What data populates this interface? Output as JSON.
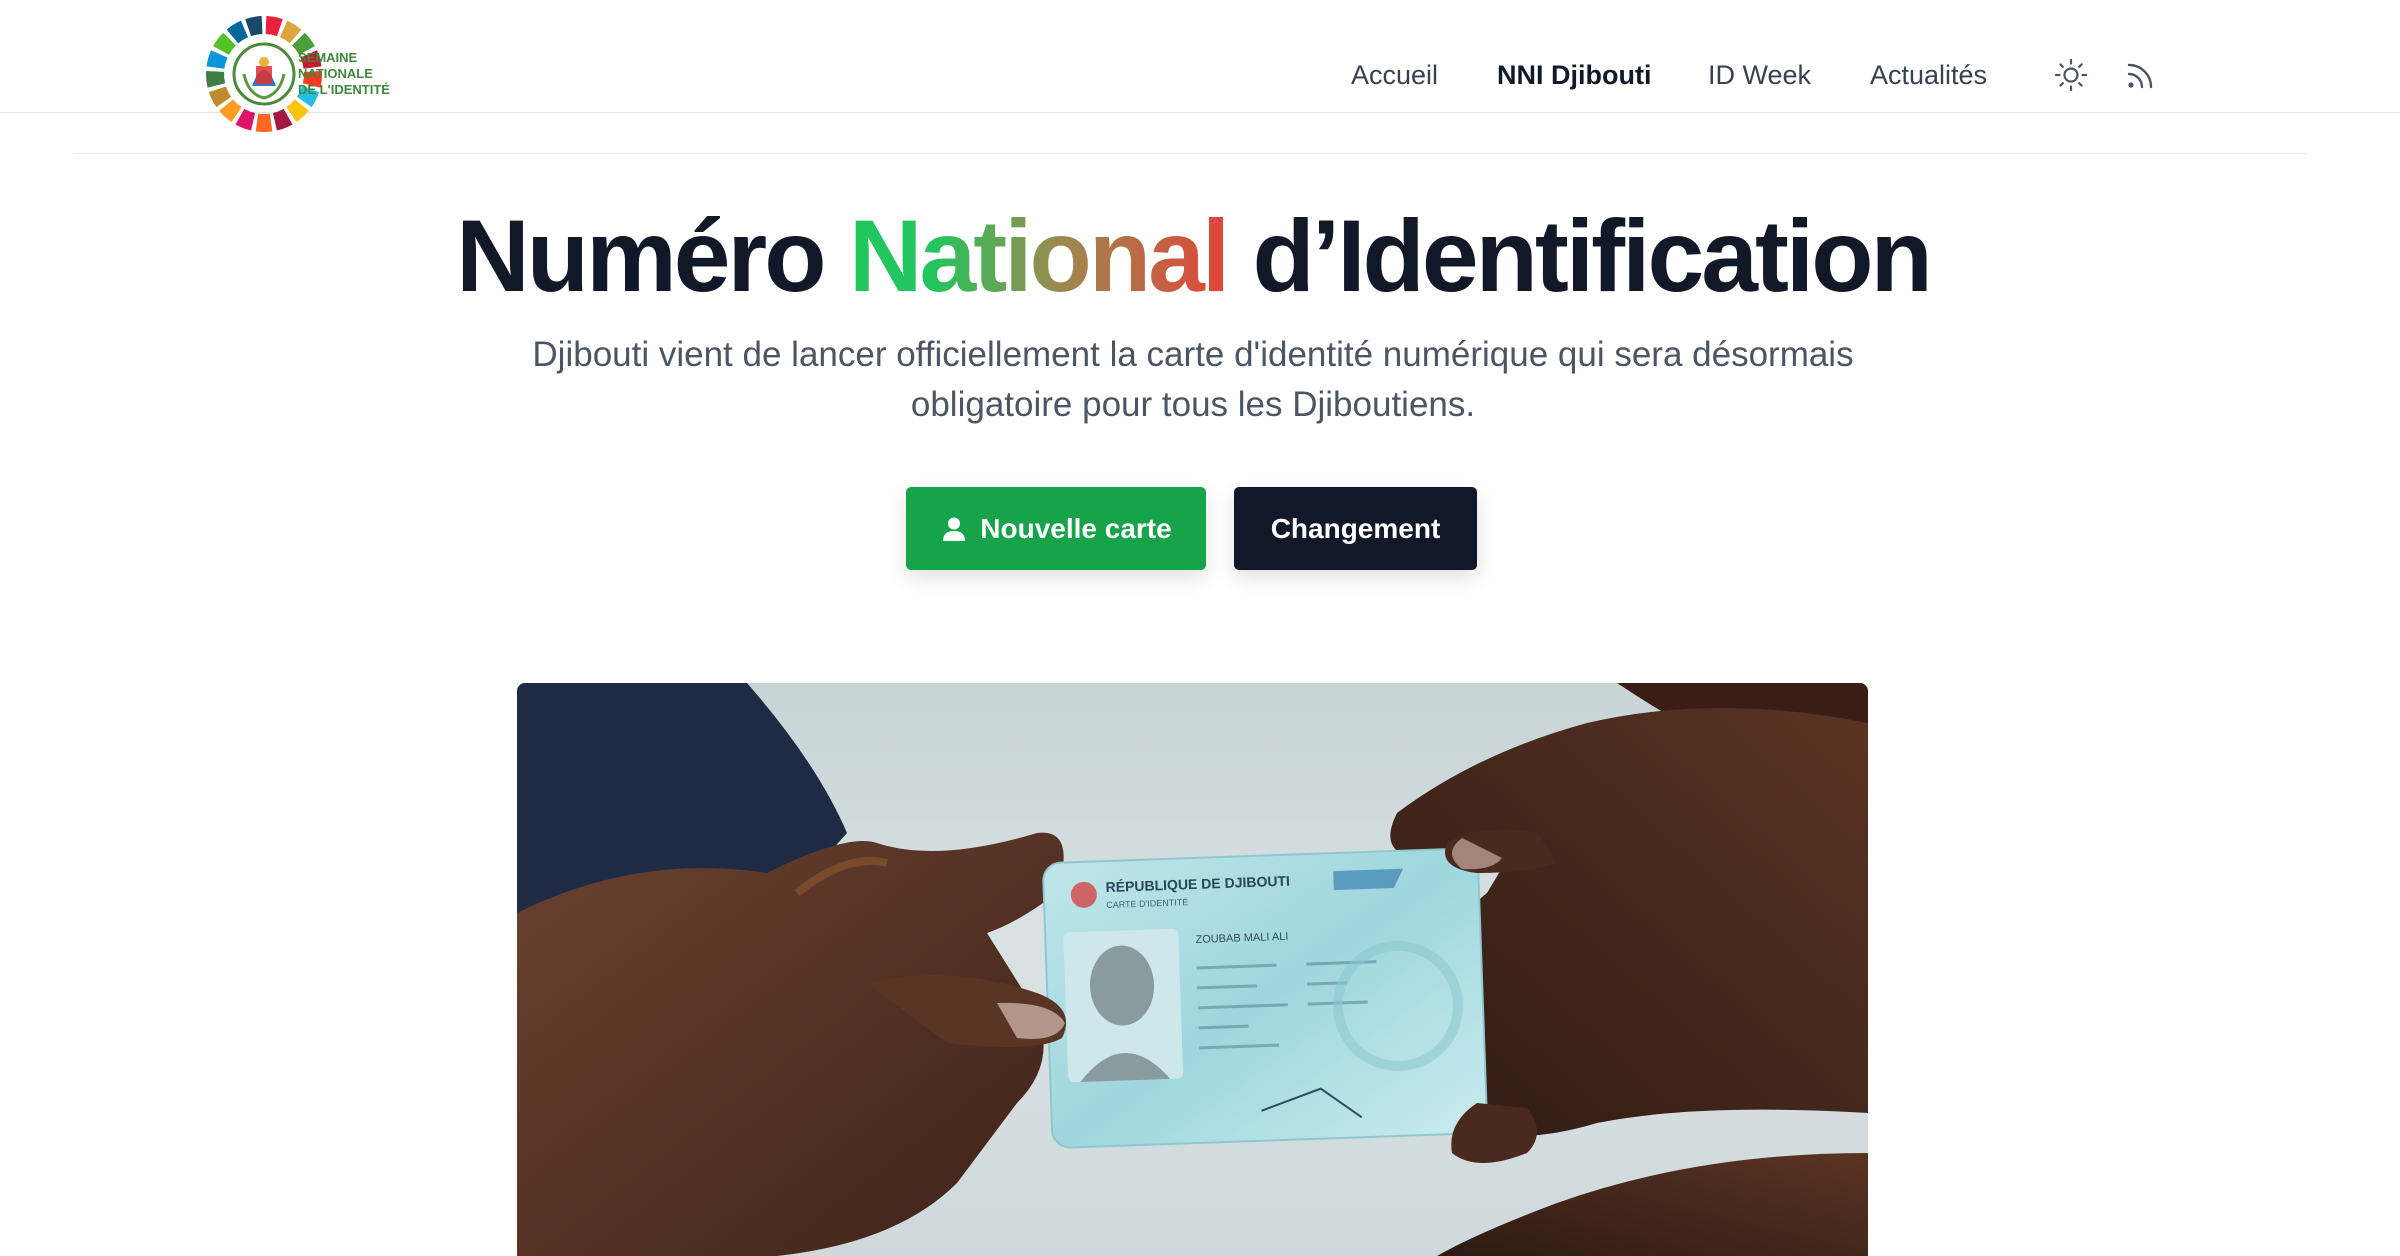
{
  "logo": {
    "lines": [
      "SEMAINE",
      "NATIONALE",
      "DE L'IDENTITÉ"
    ]
  },
  "nav": {
    "items": [
      {
        "label": "Accueil",
        "active": false
      },
      {
        "label": "NNI Djibouti",
        "active": true
      },
      {
        "label": "ID Week",
        "active": false
      },
      {
        "label": "Actualités",
        "active": false
      }
    ],
    "theme_icon": "sun-icon",
    "rss_icon": "rss-icon"
  },
  "hero": {
    "title_before": "Numéro ",
    "title_highlight": "National",
    "title_after": " d’Identification",
    "subtitle": "Djibouti vient de lancer officiellement la carte d'identité numérique qui sera désormais obligatoire pour tous les Djiboutiens.",
    "primary_button": "Nouvelle carte",
    "primary_icon": "user-icon",
    "secondary_button": "Changement"
  },
  "card": {
    "country": "RÉPUBLIQUE DE DJIBOUTI",
    "subtitle": "CARTE D'IDENTITÉ",
    "name": "ZOUBAB MALI ALI"
  },
  "colors": {
    "primary_green": "#16a34a",
    "dark": "#111827",
    "gradient_start": "#22c55e",
    "gradient_end": "#e0453a"
  }
}
